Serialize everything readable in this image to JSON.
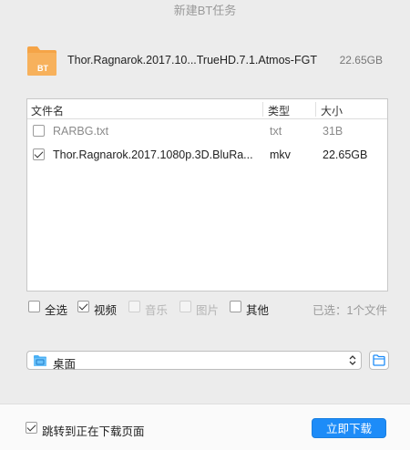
{
  "window": {
    "title": "新建BT任务"
  },
  "torrent": {
    "icon": "bt-folder-icon",
    "badge": "BT",
    "name": "Thor.Ragnarok.2017.10...TrueHD.7.1.Atmos-FGT",
    "size": "22.65GB"
  },
  "table": {
    "columns": {
      "name": "文件名",
      "type": "类型",
      "size": "大小"
    },
    "rows": [
      {
        "checked": false,
        "name": "RARBG.txt",
        "type": "txt",
        "size": "31B"
      },
      {
        "checked": true,
        "name": "Thor.Ragnarok.2017.1080p.3D.BluRa...",
        "type": "mkv",
        "size": "22.65GB"
      }
    ]
  },
  "filters": {
    "all": {
      "label": "全选",
      "checked": false,
      "enabled": true
    },
    "video": {
      "label": "视频",
      "checked": true,
      "enabled": true
    },
    "music": {
      "label": "音乐",
      "checked": false,
      "enabled": false
    },
    "image": {
      "label": "图片",
      "checked": false,
      "enabled": false
    },
    "other": {
      "label": "其他",
      "checked": false,
      "enabled": true
    },
    "summary": "已选：1个文件"
  },
  "destination": {
    "label": "桌面",
    "icon": "desktop-folder-icon"
  },
  "footer": {
    "jump_label": "跳转到正在下载页面",
    "jump_checked": true,
    "download_label": "立即下载"
  },
  "colors": {
    "accent": "#1d8cf8",
    "folder": "#f5a447"
  }
}
